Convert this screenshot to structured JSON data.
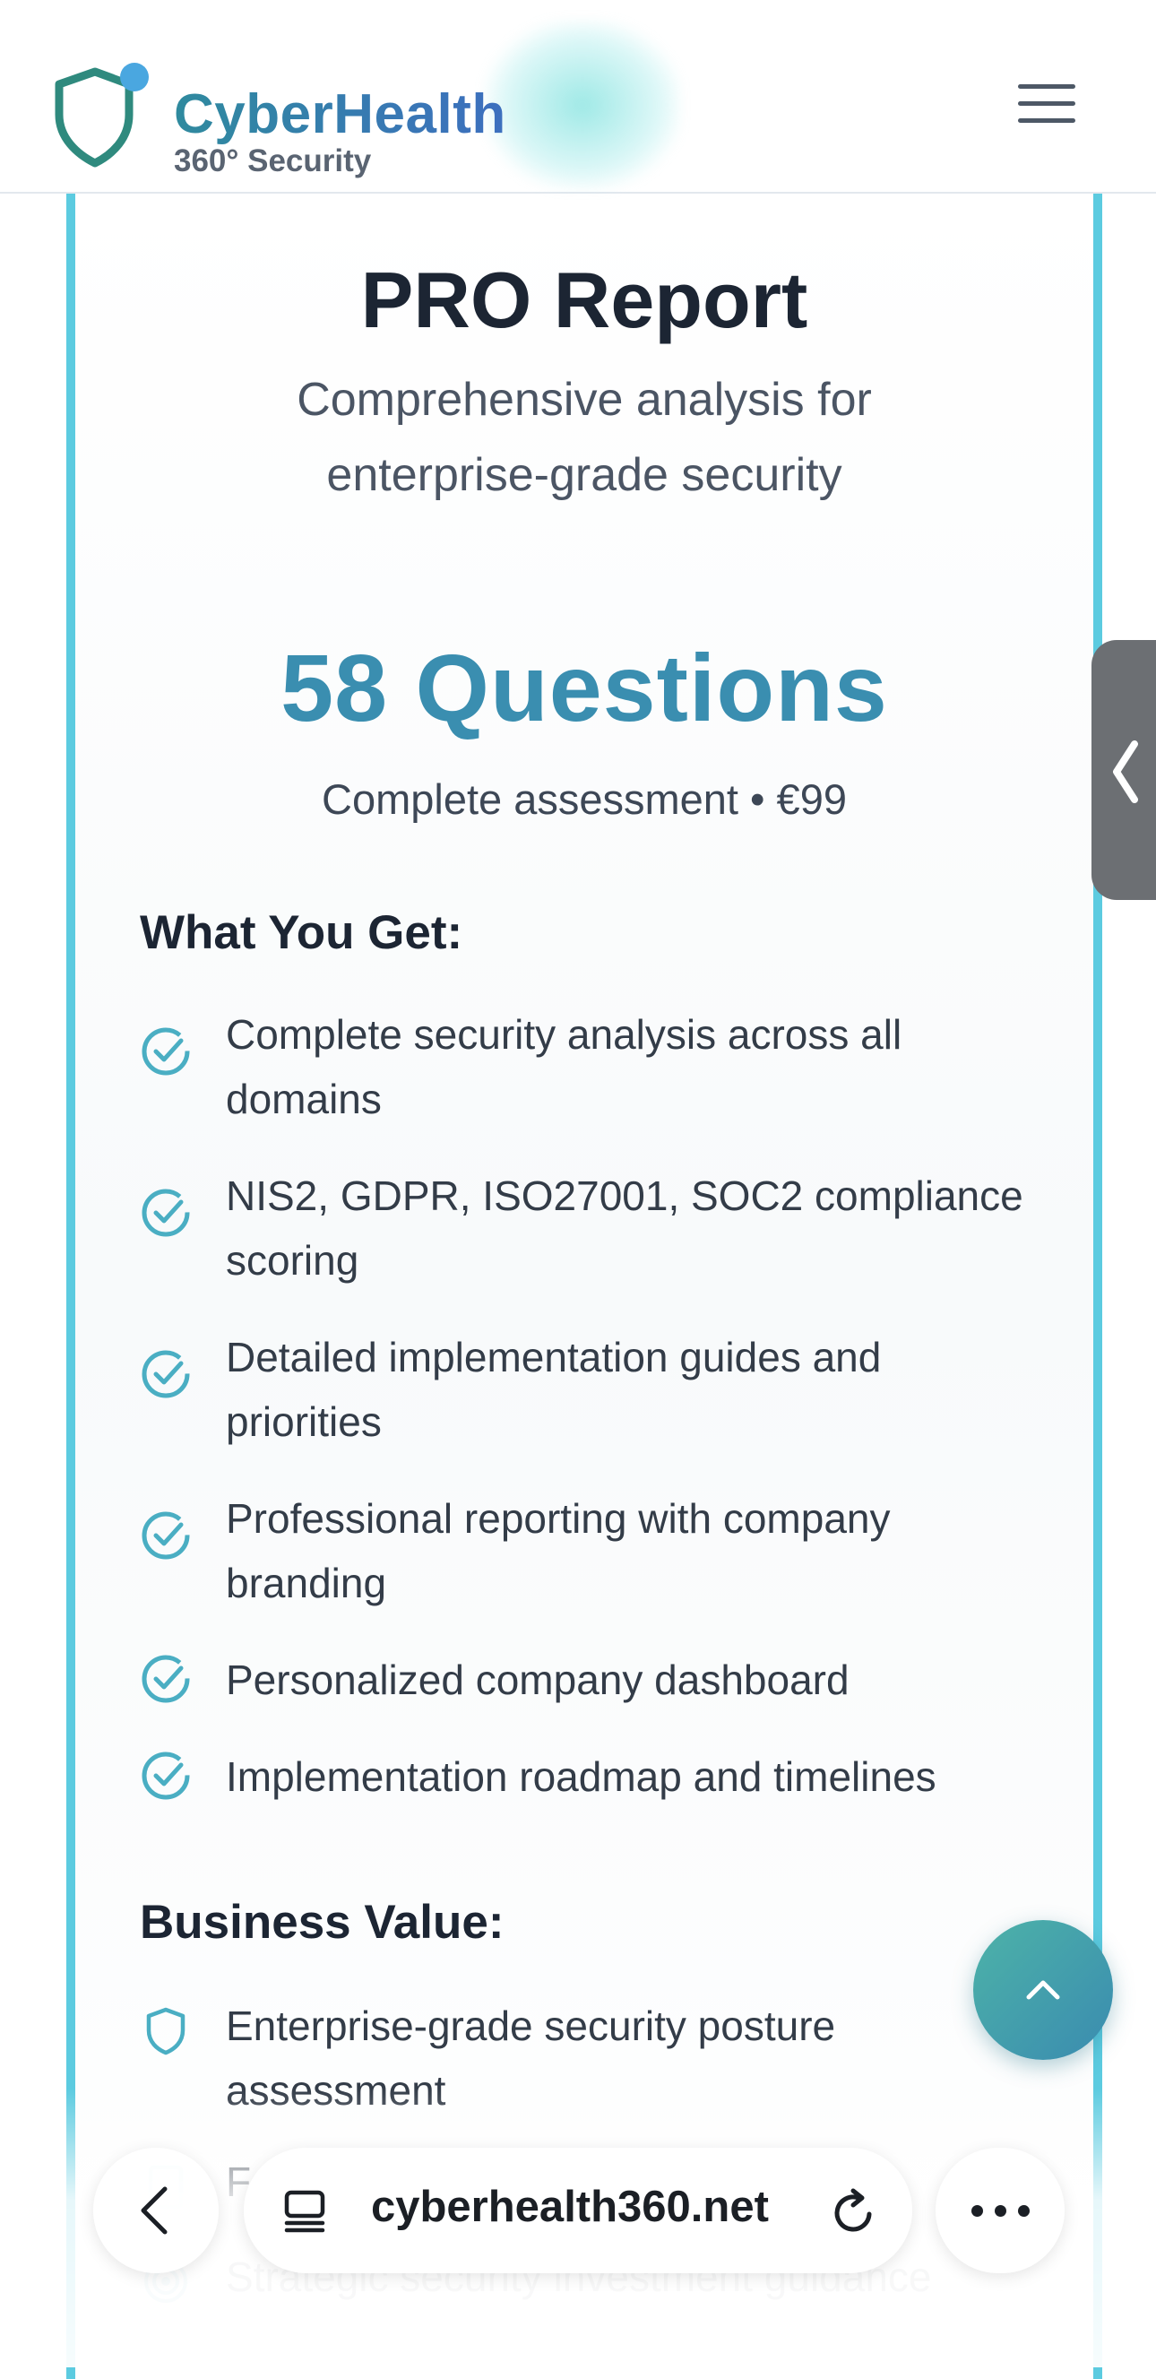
{
  "header": {
    "brand": "CyberHealth",
    "tagline": "360° Security",
    "menu_icon": "hamburger-icon"
  },
  "report": {
    "title": "PRO Report",
    "subtitle": "Comprehensive analysis for enterprise-grade security",
    "questions": "58 Questions",
    "price_line": "Complete assessment • €99"
  },
  "what_you_get": {
    "heading": "What You Get:",
    "items": [
      "Complete security analysis across all domains",
      "NIS2, GDPR, ISO27001, SOC2 compliance scoring",
      "Detailed implementation guides and priorities",
      "Professional reporting with company branding",
      "Personalized company dashboard",
      "Implementation roadmap and timelines"
    ],
    "icon": "check-circle-icon"
  },
  "business_value": {
    "heading": "Business Value:",
    "items": [
      "Enterprise-grade security posture assessment",
      "F",
      "Strategic security investment guidance"
    ],
    "icons": [
      "shield-icon",
      "document-icon",
      "target-icon"
    ]
  },
  "browser": {
    "url": "cyberhealth360.net"
  },
  "colors": {
    "accent": "#3a8eb0",
    "card_border": "#5ccbe0",
    "check": "#4aaec3"
  }
}
